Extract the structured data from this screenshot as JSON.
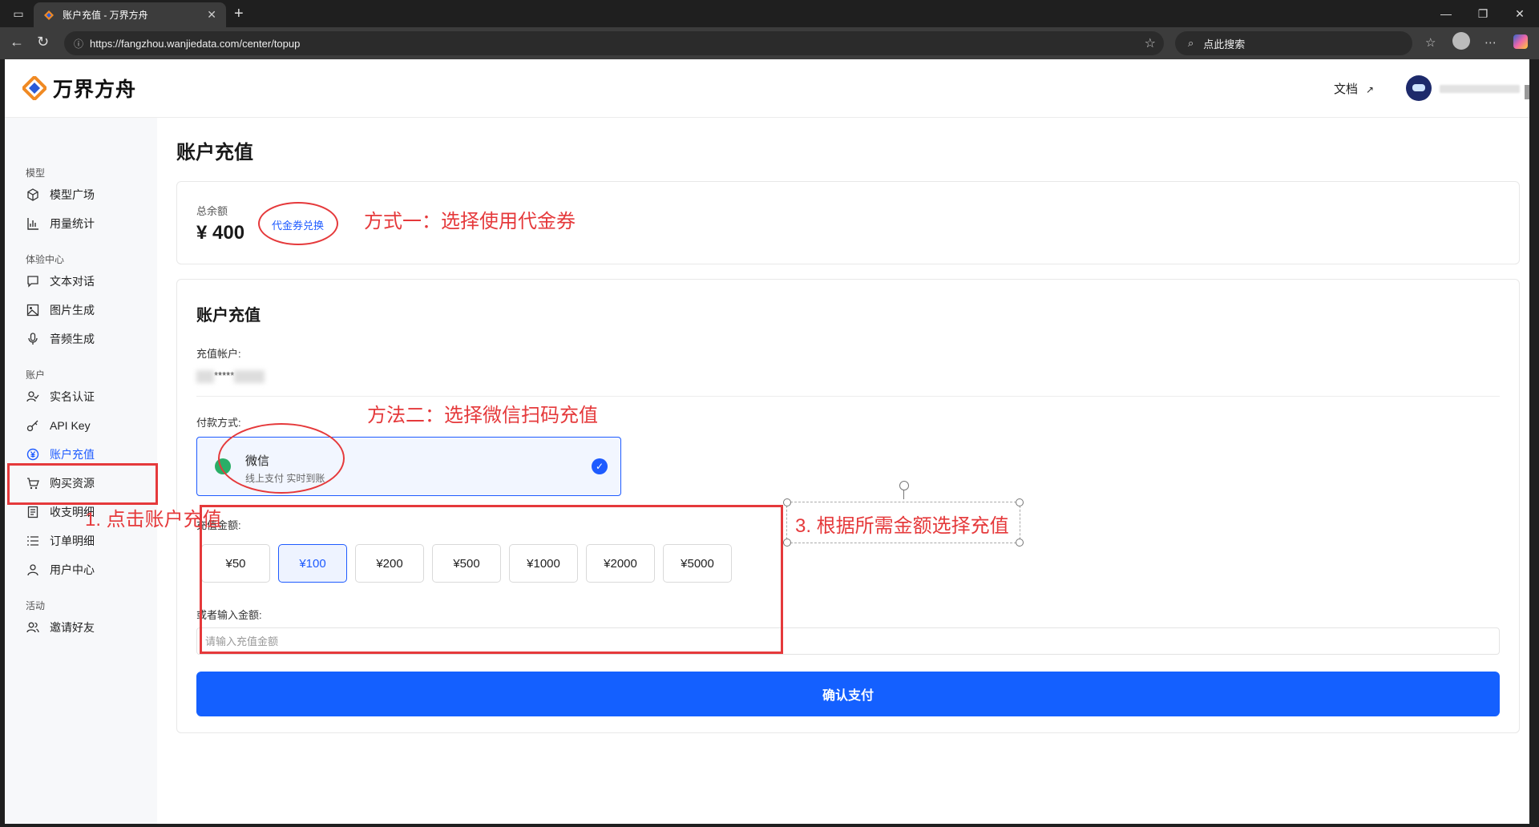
{
  "browser": {
    "tab_title": "账户充值 - 万界方舟",
    "url": "https://fangzhou.wanjiedata.com/center/topup",
    "search_placeholder": "点此搜索"
  },
  "header": {
    "logo_text": "万界方舟",
    "docs_label": "文档",
    "docs_arrow": "↗"
  },
  "sidebar": {
    "section_model": "模型",
    "section_experience": "体验中心",
    "section_account": "账户",
    "section_activity": "活动",
    "items": [
      {
        "label": "模型广场",
        "icon": "cube-icon"
      },
      {
        "label": "用量统计",
        "icon": "bar-chart-icon"
      },
      {
        "label": "文本对话",
        "icon": "chat-icon"
      },
      {
        "label": "图片生成",
        "icon": "image-icon"
      },
      {
        "label": "音频生成",
        "icon": "mic-icon"
      },
      {
        "label": "实名认证",
        "icon": "user-check-icon"
      },
      {
        "label": "API Key",
        "icon": "key-icon"
      },
      {
        "label": "账户充值",
        "icon": "yen-icon"
      },
      {
        "label": "购买资源",
        "icon": "cart-icon"
      },
      {
        "label": "收支明细",
        "icon": "doc-icon"
      },
      {
        "label": "订单明细",
        "icon": "list-icon"
      },
      {
        "label": "用户中心",
        "icon": "user-icon"
      },
      {
        "label": "邀请好友",
        "icon": "users-icon"
      }
    ]
  },
  "main": {
    "page_title": "账户充值",
    "balance_label": "总余额",
    "balance_value": "¥ 400",
    "voucher_link": "代金券兑换",
    "card_title": "账户充值",
    "account_label": "充值帐户:",
    "account_value": "*****",
    "payment_label": "付款方式:",
    "wechat_name": "微信",
    "wechat_sub": "线上支付 实时到账",
    "amount_label": "充值金额:",
    "amounts": [
      "¥50",
      "¥100",
      "¥200",
      "¥500",
      "¥1000",
      "¥2000",
      "¥5000"
    ],
    "selected_amount": "¥100",
    "custom_label": "或者输入金额:",
    "custom_placeholder": "请输入充值金额",
    "confirm_button": "确认支付"
  },
  "annotations": {
    "method1": "方式一：选择使用代金券",
    "method2": "方法二：选择微信扫码充值",
    "step1": "1. 点击账户充值",
    "step3": "3. 根据所需金额选择充值",
    "color": "#e5393b"
  },
  "colors": {
    "accent": "#1e5bff",
    "wechat": "#2aae67"
  }
}
